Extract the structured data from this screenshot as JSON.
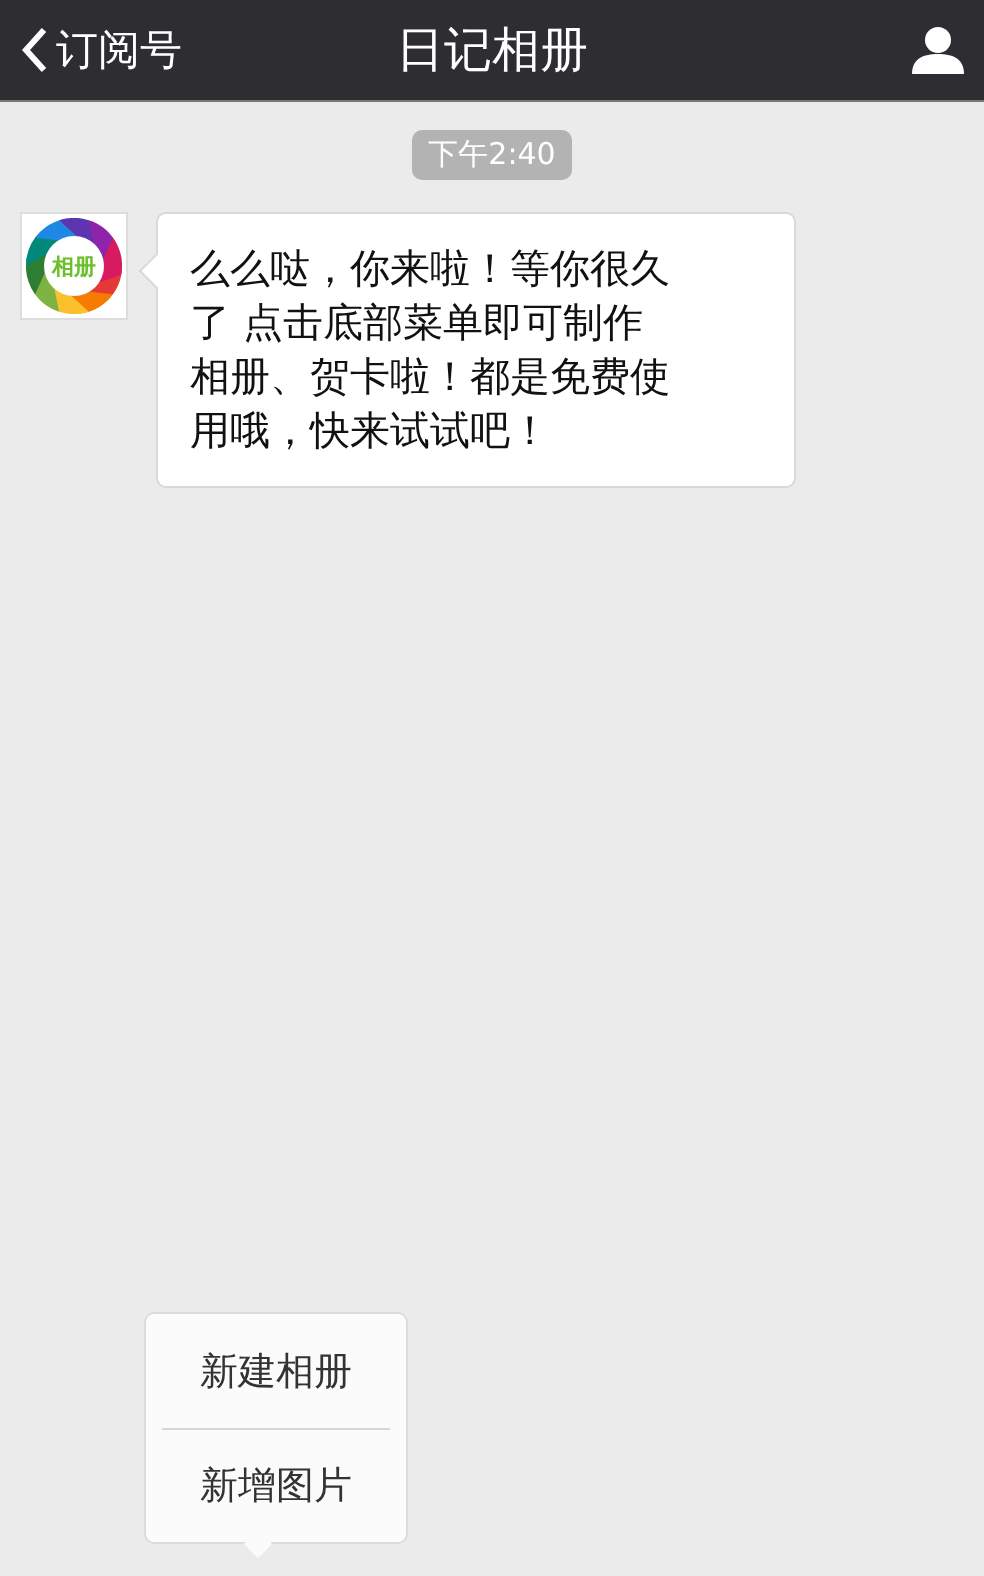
{
  "header": {
    "back_label": "订阅号",
    "title": "日记相册"
  },
  "messages": [
    {
      "time": "下午2:40",
      "sender_logo_text": "相册",
      "text": "么么哒，你来啦！等你很久了 点击底部菜单即可制作相册、贺卡啦！都是免费使用哦，快来试试吧！"
    }
  ],
  "popup_menu": {
    "items": [
      {
        "label": "新建相册"
      },
      {
        "label": "新增图片"
      }
    ]
  }
}
